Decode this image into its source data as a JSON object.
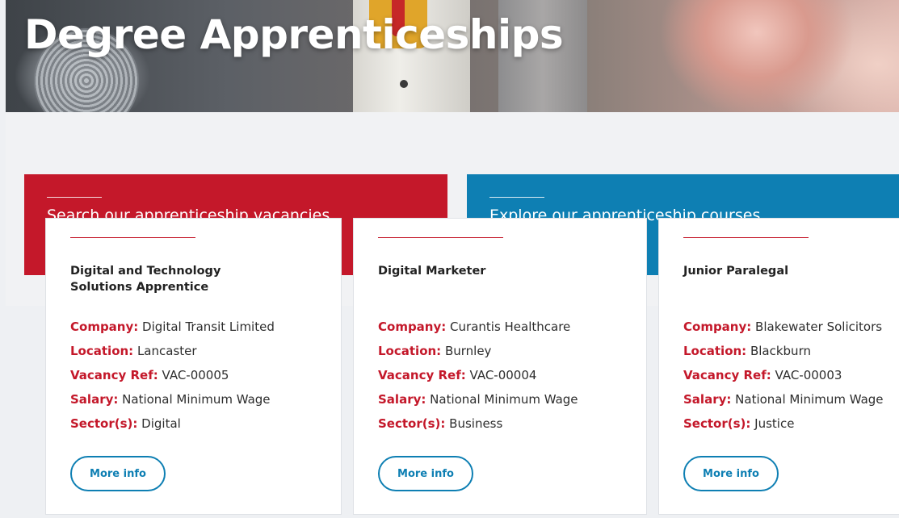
{
  "hero": {
    "title": "Degree Apprenticeships"
  },
  "tiles": [
    {
      "label": "Search our apprenticeship vacancies",
      "color": "#c4182a"
    },
    {
      "label": "Explore our apprenticeship courses",
      "color": "#0e7fb3"
    }
  ],
  "field_labels": {
    "company": "Company:",
    "location": "Location:",
    "ref": "Vacancy Ref:",
    "salary": "Salary:",
    "sectors": "Sector(s):"
  },
  "vacancies": [
    {
      "title": "Digital and Technology Solutions Apprentice",
      "company": "Digital Transit Limited",
      "location": "Lancaster",
      "ref": "VAC-00005",
      "salary": "National Minimum Wage",
      "sectors": "Digital",
      "button": "More info"
    },
    {
      "title": "Digital Marketer",
      "company": "Curantis Healthcare",
      "location": "Burnley",
      "ref": "VAC-00004",
      "salary": "National Minimum Wage",
      "sectors": "Business",
      "button": "More info"
    },
    {
      "title": "Junior Paralegal",
      "company": "Blakewater Solicitors",
      "location": "Blackburn",
      "ref": "VAC-00003",
      "salary": "National Minimum Wage",
      "sectors": "Justice",
      "button": "More info"
    }
  ],
  "colors": {
    "accent_red": "#c4182a",
    "accent_blue": "#0e7fb3"
  }
}
